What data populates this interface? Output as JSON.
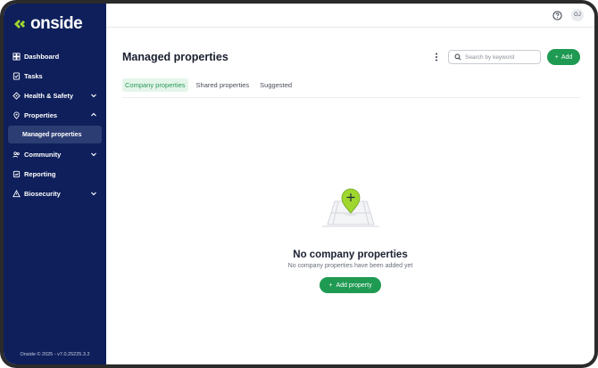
{
  "brand": {
    "name": "onside"
  },
  "sidebar": {
    "items": [
      {
        "label": "Dashboard",
        "icon": "dashboard-icon"
      },
      {
        "label": "Tasks",
        "icon": "tasks-icon"
      },
      {
        "label": "Health & Safety",
        "icon": "health-safety-icon"
      },
      {
        "label": "Properties",
        "icon": "properties-icon"
      },
      {
        "label": "Community",
        "icon": "community-icon"
      },
      {
        "label": "Reporting",
        "icon": "reporting-icon"
      },
      {
        "label": "Biosecurity",
        "icon": "biosecurity-icon"
      }
    ],
    "sub_item": "Managed properties",
    "footer": "Onside © 2025 - v7.0.25225.3.2"
  },
  "topbar": {
    "avatar_initials": "GJ"
  },
  "page": {
    "title": "Managed properties",
    "search_placeholder": "Search by keyword",
    "add_label": "Add"
  },
  "tabs": [
    {
      "label": "Company properties",
      "active": true
    },
    {
      "label": "Shared properties",
      "active": false
    },
    {
      "label": "Suggested",
      "active": false
    }
  ],
  "empty_state": {
    "title": "No company properties",
    "subtitle": "No company properties have been added yet",
    "button": "Add property"
  },
  "colors": {
    "sidebar_bg": "#0e1f5b",
    "accent_green": "#1f9a52",
    "logo_green": "#9fd72e",
    "active_tab_bg": "#e4f5ea"
  }
}
